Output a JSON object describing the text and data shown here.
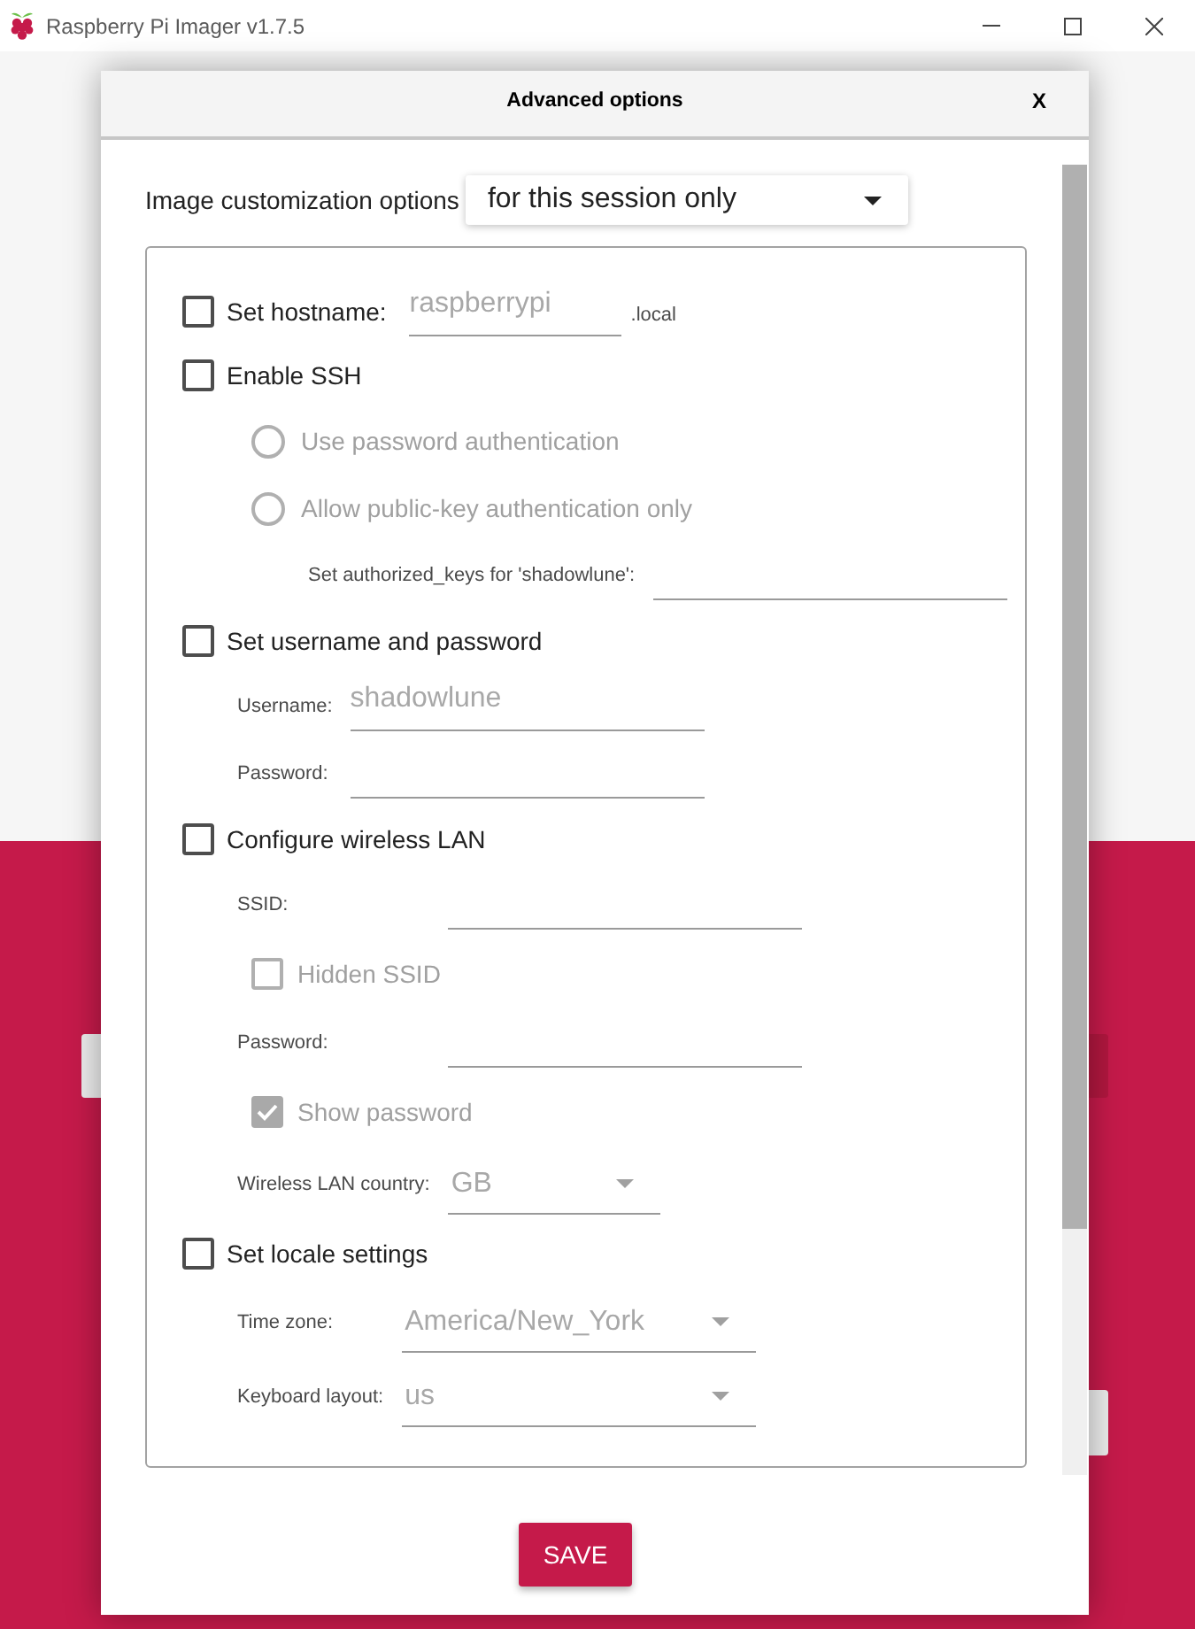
{
  "window": {
    "title": "Raspberry Pi Imager v1.7.5"
  },
  "dialog": {
    "title": "Advanced options",
    "close": "X",
    "customization": {
      "label": "Image customization options",
      "value": "for this session only"
    },
    "options": [
      {
        "kind": "checkbox",
        "label": "Set hostname:",
        "checked": false,
        "field": {
          "value": "raspberrypi",
          "disabled": true
        },
        "suffix": ".local"
      },
      {
        "kind": "checkbox",
        "label": "Enable SSH",
        "checked": false,
        "children": [
          {
            "kind": "radio",
            "label": "Use password authentication",
            "selected": false,
            "disabled": true
          },
          {
            "kind": "radio",
            "label": "Allow public-key authentication only",
            "selected": false,
            "disabled": true
          },
          {
            "kind": "field",
            "label": "Set authorized_keys for 'shadowlune':"
          }
        ]
      },
      {
        "kind": "checkbox",
        "label": "Set username and password",
        "checked": false,
        "children": [
          {
            "kind": "field",
            "label": "Username:",
            "value": "shadowlune",
            "disabled": true
          },
          {
            "kind": "field",
            "label": "Password:"
          }
        ]
      },
      {
        "kind": "checkbox",
        "label": "Configure wireless LAN",
        "checked": false,
        "children": [
          {
            "kind": "field",
            "label": "SSID:"
          },
          {
            "kind": "checkbox",
            "label": "Hidden SSID",
            "checked": false,
            "disabled": true
          },
          {
            "kind": "field",
            "label": "Password:"
          },
          {
            "kind": "checkbox",
            "label": "Show password",
            "checked": true,
            "disabled": true
          },
          {
            "kind": "compact_combo",
            "label": "Wireless LAN country:",
            "value": "GB",
            "disabled": true
          }
        ]
      },
      {
        "kind": "checkbox",
        "label": "Set locale settings",
        "checked": false,
        "children": [
          {
            "kind": "combo",
            "label": "Time zone:",
            "value": "America/New_York",
            "disabled": true
          },
          {
            "kind": "combo",
            "label": "Keyboard layout:",
            "value": "us",
            "disabled": true
          }
        ]
      }
    ],
    "save": "SAVE"
  }
}
